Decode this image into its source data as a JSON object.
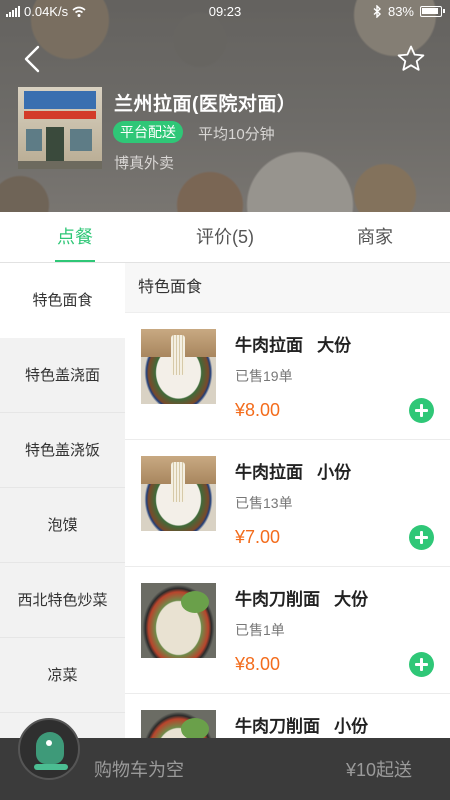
{
  "status_bar": {
    "network": "4G",
    "speed": "0.04K/s",
    "time": "09:23",
    "battery": "83%"
  },
  "store": {
    "name": "兰州拉面(医院对面）",
    "delivery_badge": "平台配送",
    "avg_time": "平均10分钟",
    "delivery_by": "博真外卖"
  },
  "tabs": [
    {
      "label": "点餐",
      "active": true
    },
    {
      "label": "评价(5)",
      "active": false
    },
    {
      "label": "商家",
      "active": false
    }
  ],
  "categories": [
    {
      "label": "特色面食",
      "active": true
    },
    {
      "label": "特色盖浇面",
      "active": false
    },
    {
      "label": "特色盖浇饭",
      "active": false
    },
    {
      "label": "泡馍",
      "active": false
    },
    {
      "label": "西北特色炒菜",
      "active": false
    },
    {
      "label": "凉菜",
      "active": false
    }
  ],
  "menu": {
    "section_title": "特色面食",
    "items": [
      {
        "name": "牛肉拉面   大份",
        "sold": "已售19单",
        "price": "¥8.00"
      },
      {
        "name": "牛肉拉面   小份",
        "sold": "已售13单",
        "price": "¥7.00"
      },
      {
        "name": "牛肉刀削面   大份",
        "sold": "已售1单",
        "price": "¥8.00"
      },
      {
        "name": "牛肉刀削面   小份",
        "sold": "",
        "price": ""
      }
    ]
  },
  "cart": {
    "empty_text": "购物车为空",
    "min_order": "¥10起送"
  },
  "colors": {
    "accent": "#2fc777",
    "price": "#f36c1c",
    "cart_bar": "#3b3b3b"
  }
}
